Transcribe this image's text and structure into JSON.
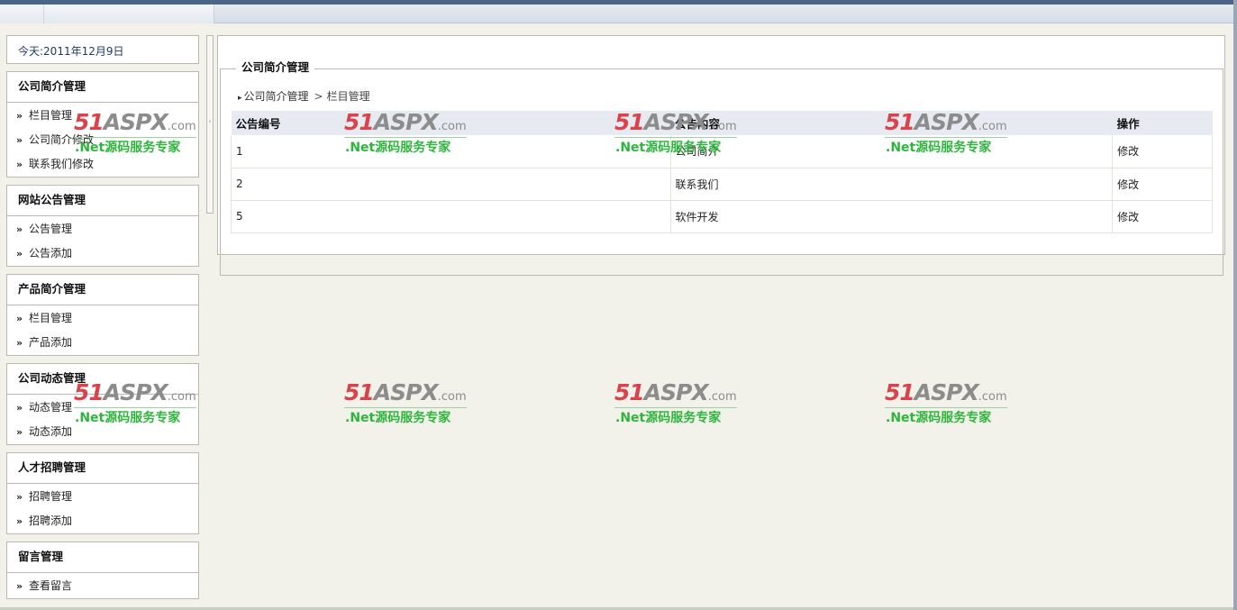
{
  "date_text": "今天:2011年12月9日",
  "sidebar": {
    "groups": [
      {
        "title": "公司简介管理",
        "items": [
          "栏目管理",
          "公司简介修改",
          "联系我们修改"
        ]
      },
      {
        "title": "网站公告管理",
        "items": [
          "公告管理",
          "公告添加"
        ]
      },
      {
        "title": "产品简介管理",
        "items": [
          "栏目管理",
          "产品添加"
        ]
      },
      {
        "title": "公司动态管理",
        "items": [
          "动态管理",
          "动态添加"
        ]
      },
      {
        "title": "人才招聘管理",
        "items": [
          "招聘管理",
          "招聘添加"
        ]
      },
      {
        "title": "留言管理",
        "items": [
          "查看留言"
        ]
      }
    ],
    "item_prefix": "»",
    "collapse_glyph": "‹"
  },
  "main": {
    "legend": "公司简介管理",
    "breadcrumb": {
      "root": "公司简介管理",
      "separator": ">",
      "current": "栏目管理"
    },
    "table": {
      "headers": [
        "公告编号",
        "公告内容",
        "操作"
      ],
      "rows": [
        [
          "1",
          "公司简介",
          "修改"
        ],
        [
          "2",
          "联系我们",
          "修改"
        ],
        [
          "5",
          "软件开发",
          "修改"
        ]
      ]
    }
  },
  "watermark": {
    "brand_num": "51",
    "brand_name": "ASPX",
    "brand_suffix": ".com",
    "tagline": ".Net源码服务专家",
    "colors": {
      "num": "#d9434b",
      "name": "#8c8c8c",
      "tag": "#2fb43d"
    }
  }
}
